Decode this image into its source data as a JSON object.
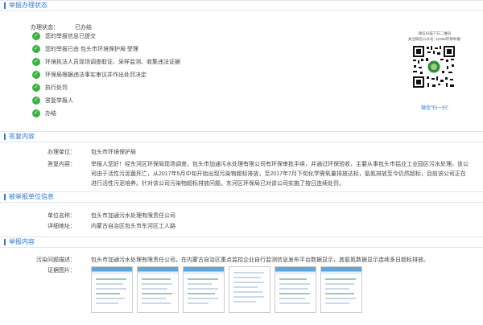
{
  "sections": {
    "status_title": "举报办理状态",
    "reply_title": "答复内容",
    "reported_title": "被举报单位信息",
    "report_title": "举报内容"
  },
  "status": {
    "label": "办理状态：",
    "value": "已办结",
    "steps": [
      "您的举报信息已提交",
      "您的举报已由 包头市环境保护局 受理",
      "环境执法人员现场调查取证、采样监测、收集违法证据",
      "环保局根据违法事实审议并作出处罚决定",
      "执行处罚",
      "答复举报人",
      "办结"
    ]
  },
  "qr": {
    "caption_line1": "微信扫描下方二维码",
    "caption_line2": "关注微信公众号 “12369环保举报”",
    "footer": "微信“扫一扫”"
  },
  "reply": {
    "unit_label": "办理单位：",
    "unit_value": "包头市环境保护局",
    "content_label": "答复内容：",
    "content_value": "举报人您好！经东河区环保局现场调查，包头市加通污水处理有限公司有环保审批手续，并通过环保验收，主要从事包头市铝业工业园区污水处理。该公司由于活性污泥菌死亡，从2017年5月中旬开始出现污染物超标排放，至2017年7月下旬化学需氧量排放达标，氨氮排放至今仍然超标，目前该公司正在进行活性污泥培养。针对该公司污染物超标排放问题，东河区环保局已对该公司实施了按日连续处罚。"
  },
  "reported": {
    "name_label": "单位名称：",
    "name_value": "包头市加通污水处理有限责任公司",
    "address_label": "详细地址：",
    "address_value": "内蒙古自治区包头市东河区工人路"
  },
  "report": {
    "desc_label": "污染问题描述：",
    "desc_value": "包头市加通污水处理有限责任公司，在内蒙古自治区重点监控企业自行监测信息发布平台数据显示，其氨氮数据显示连续多日超标排放。",
    "evidence_label": "证据图片："
  },
  "colors": {
    "accent": "#2e7bcf",
    "check": "#3cb043"
  }
}
